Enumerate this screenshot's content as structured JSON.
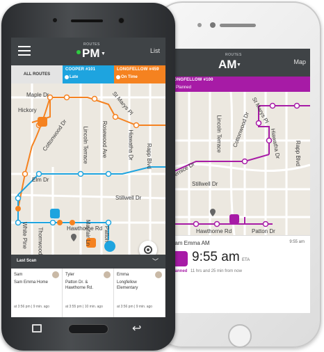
{
  "left_phone": {
    "header": {
      "routes_caption": "ROUTES",
      "period": "PM",
      "list_link": "List"
    },
    "tabs": [
      {
        "title": "ALL ROUTES"
      },
      {
        "title": "COOPER #101",
        "status": "Late",
        "color": "#1ea4df"
      },
      {
        "title": "LONGFELLOW #459",
        "status": "On Time",
        "color": "#f58220"
      }
    ],
    "streets": [
      "Maple Dr",
      "Hickory",
      "St Marys Pl",
      "Cottonwood Dr",
      "Lincoln Terrace",
      "Rosewood Ave",
      "Hiawatha Dr",
      "Rapp Blvd",
      "Stillwell Dr",
      "Elm Dr",
      "Hawthorne Rd",
      "White Pine",
      "Thornwood",
      "Mayfair Ln",
      "Patton"
    ],
    "last_scan": {
      "title": "Last Scan",
      "items": [
        {
          "name": "Sam",
          "place": "Sam Emma Home",
          "when": "at 3:56 pm",
          "ago": "9 min. ago"
        },
        {
          "name": "Tyler",
          "place": "Patton Dr. & Hawthorne Rd.",
          "when": "at 3:55 pm",
          "ago": "10 min. ago"
        },
        {
          "name": "Emma",
          "place": "Longfellow Elementary",
          "when": "at 3:56 pm",
          "ago": "9 min. ago"
        }
      ]
    }
  },
  "right_phone": {
    "header": {
      "routes_caption": "ROUTES",
      "period": "AM",
      "map_link": "Map"
    },
    "banner": {
      "route": "LONGFELLOW #100",
      "status": "Planned",
      "color": "#a71ba6"
    },
    "streets": [
      "St Marys Pl",
      "Cottonwood Dr",
      "Hiawatha Dr",
      "Rapp Blvd",
      "Stillwell Dr",
      "Bernice Dr",
      "Hawthorne Rd",
      "Patton Dr",
      "Lincoln Terrace"
    ],
    "card": {
      "name": "Sam Emma AM",
      "time_small": "9:55 am",
      "time_big": "9:55 am",
      "eta_label": "ETA",
      "status": "Planned",
      "from_now": "11 hrs and 25 min from now"
    }
  }
}
